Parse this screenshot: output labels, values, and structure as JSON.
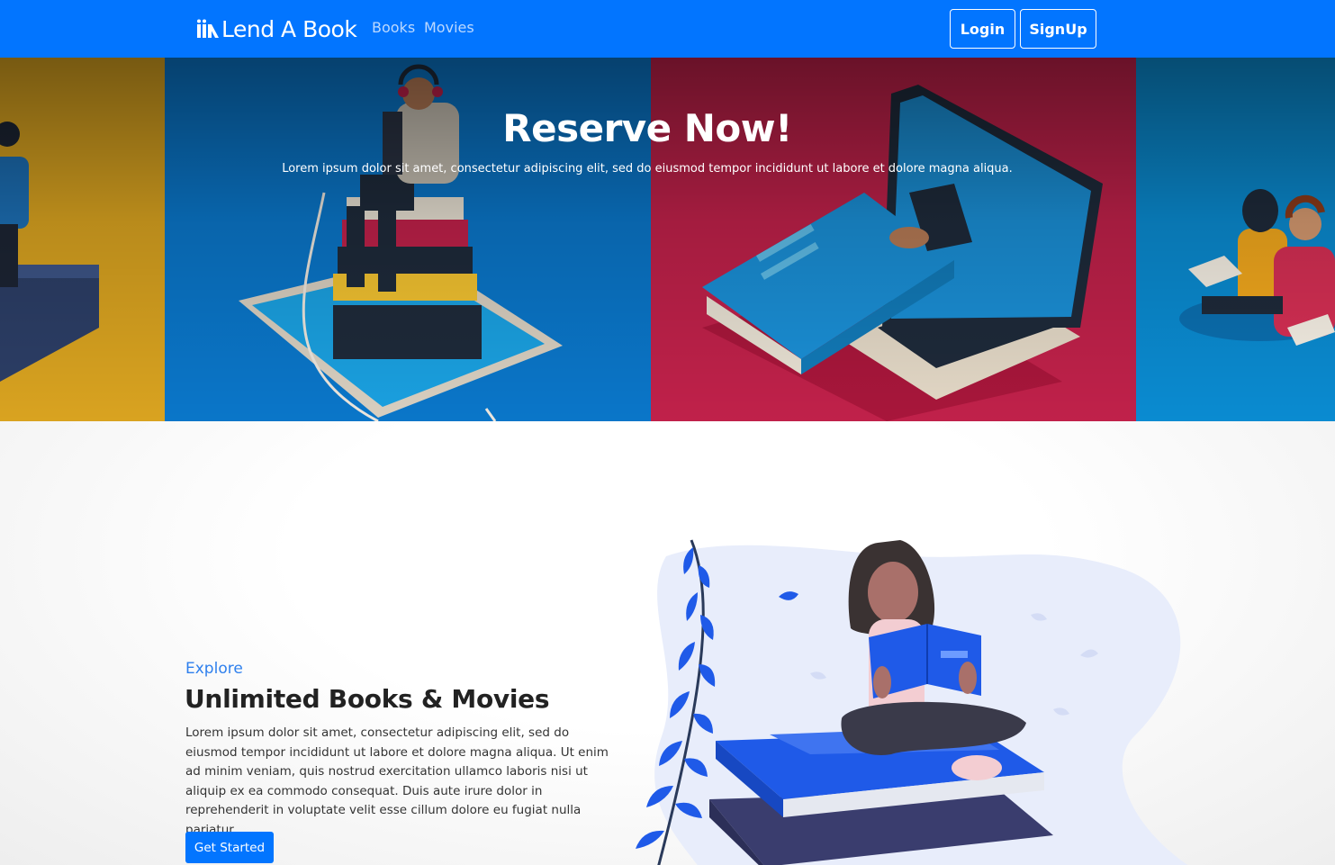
{
  "navbar": {
    "brand": "Lend A Book",
    "links": [
      "Books",
      "Movies"
    ],
    "login_label": "Login",
    "signup_label": "SignUp",
    "bg_color": "#0275ff"
  },
  "hero": {
    "title": "Reserve Now!",
    "subtitle": "Lorem ipsum dolor sit amet, consectetur adipiscing elit, sed do eiusmod tempor incididunt ut labore et dolore magna aliqua.",
    "panel_colors": [
      "#d9a320",
      "#0a76c9",
      "#c0214a",
      "#0a8bd1"
    ]
  },
  "feature": {
    "eyebrow": "Explore",
    "title": "Unlimited Books & Movies",
    "text": "Lorem ipsum dolor sit amet, consectetur adipiscing elit, sed do eiusmod tempor incididunt ut labore et dolore magna aliqua. Ut enim ad minim veniam, quis nostrud exercitation ullamco laboris nisi ut aliquip ex ea commodo consequat. Duis aute irure dolor in reprehenderit in voluptate velit esse cillum dolore eu fugiat nulla pariatur.",
    "cta_label": "Get Started",
    "accent_color": "#2f80ed"
  }
}
